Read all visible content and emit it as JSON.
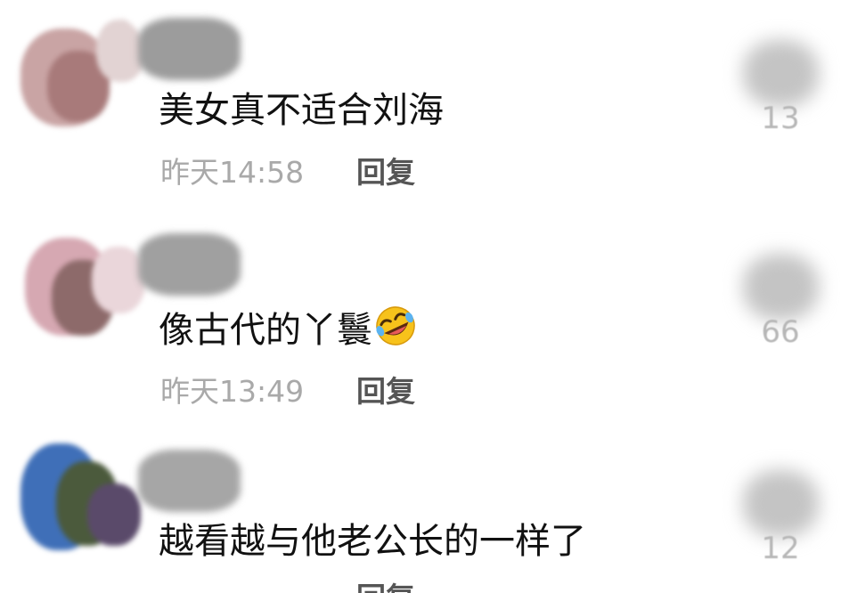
{
  "comments": [
    {
      "text": "美女真不适合刘海",
      "time": "昨天14:58",
      "reply_label": "回复",
      "like_count": "13",
      "avatar_colors": [
        "#c9a4a4",
        "#a87a7a",
        "#e2d3d3"
      ],
      "emoji_icon": ""
    },
    {
      "text": "像古代的丫鬟",
      "time": "昨天13:49",
      "reply_label": "回复",
      "like_count": "66",
      "avatar_colors": [
        "#d6a8b2",
        "#8d6a6a",
        "#ead6da"
      ],
      "emoji_icon": "rolling-on-floor-laughing-emoji"
    },
    {
      "text": "越看越与他老公长的一样了",
      "time": "",
      "reply_label": "回复",
      "like_count": "12",
      "avatar_colors": [
        "#3f6fb8",
        "#4b5a3c",
        "#5a4a6a"
      ],
      "emoji_icon": ""
    }
  ],
  "colors": {
    "text": "#111111",
    "time": "#a9a9a9",
    "reply": "#555555",
    "like_count": "#b7b7b7",
    "emoji_face": "#f7c21b"
  }
}
